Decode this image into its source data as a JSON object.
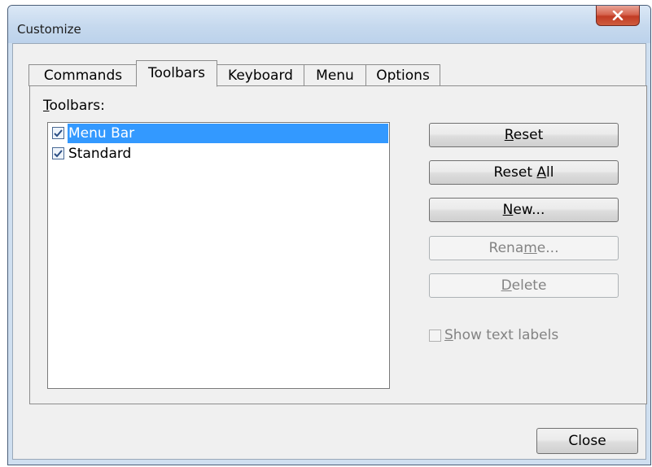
{
  "window": {
    "title": "Customize",
    "close_icon": "close-x-icon"
  },
  "tabs": [
    {
      "label": "Commands",
      "active": false
    },
    {
      "label": "Toolbars",
      "active": true
    },
    {
      "label": "Keyboard",
      "active": false
    },
    {
      "label": "Menu",
      "active": false
    },
    {
      "label": "Options",
      "active": false
    }
  ],
  "toolbars_panel": {
    "group_label": {
      "accel": "T",
      "rest": "oolbars:"
    },
    "items": [
      {
        "label": "Menu Bar",
        "checked": true,
        "selected": true
      },
      {
        "label": "Standard",
        "checked": true,
        "selected": false
      }
    ],
    "buttons": {
      "reset": {
        "accel": "R",
        "rest": "eset",
        "enabled": true
      },
      "reset_all": {
        "pre": "Reset ",
        "accel": "A",
        "rest": "ll",
        "enabled": true
      },
      "new": {
        "accel": "N",
        "rest": "ew...",
        "enabled": true
      },
      "rename": {
        "pre": "Rena",
        "accel": "m",
        "rest": "e...",
        "enabled": false
      },
      "delete": {
        "accel": "D",
        "rest": "elete",
        "enabled": false
      }
    },
    "show_text_labels": {
      "accel": "S",
      "rest": "how text labels",
      "checked": false,
      "enabled": false
    }
  },
  "footer": {
    "close_label": "Close"
  },
  "colors": {
    "selection": "#3399ff",
    "close_button": "#c13b24",
    "disabled_text": "#838383"
  }
}
